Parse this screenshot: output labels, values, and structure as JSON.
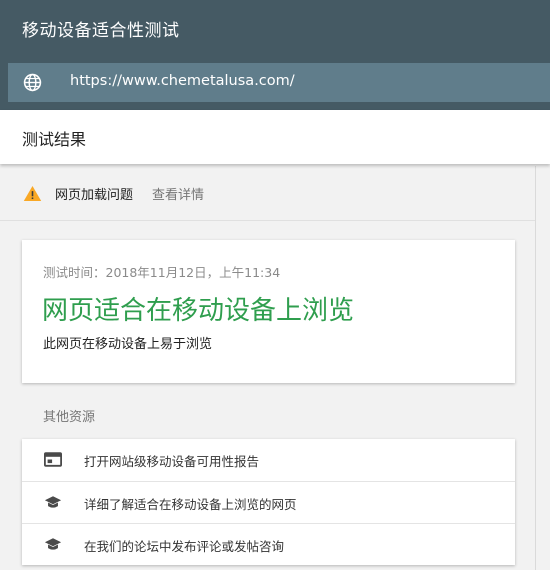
{
  "header": {
    "title": "移动设备适合性测试",
    "url": "https://www.chemetalusa.com/"
  },
  "results": {
    "title": "测试结果"
  },
  "issue": {
    "label": "网页加载问题",
    "link": "查看详情"
  },
  "result_card": {
    "test_time": "测试时间：2018年11月12日，上午11:34",
    "headline": "网页适合在移动设备上浏览",
    "subtext": "此网页在移动设备上易于浏览",
    "headline_color": "#2f9e4e"
  },
  "other_resources": {
    "title": "其他资源",
    "items": [
      {
        "icon": "browser-report-icon",
        "label": "打开网站级移动设备可用性报告"
      },
      {
        "icon": "graduation-cap-icon",
        "label": "详细了解适合在移动设备上浏览的网页"
      },
      {
        "icon": "graduation-cap-icon",
        "label": "在我们的论坛中发布评论或发帖咨询"
      }
    ]
  },
  "colors": {
    "topbar": "#455a64",
    "urlbar": "#607d8b",
    "warning": "#f9a825"
  }
}
